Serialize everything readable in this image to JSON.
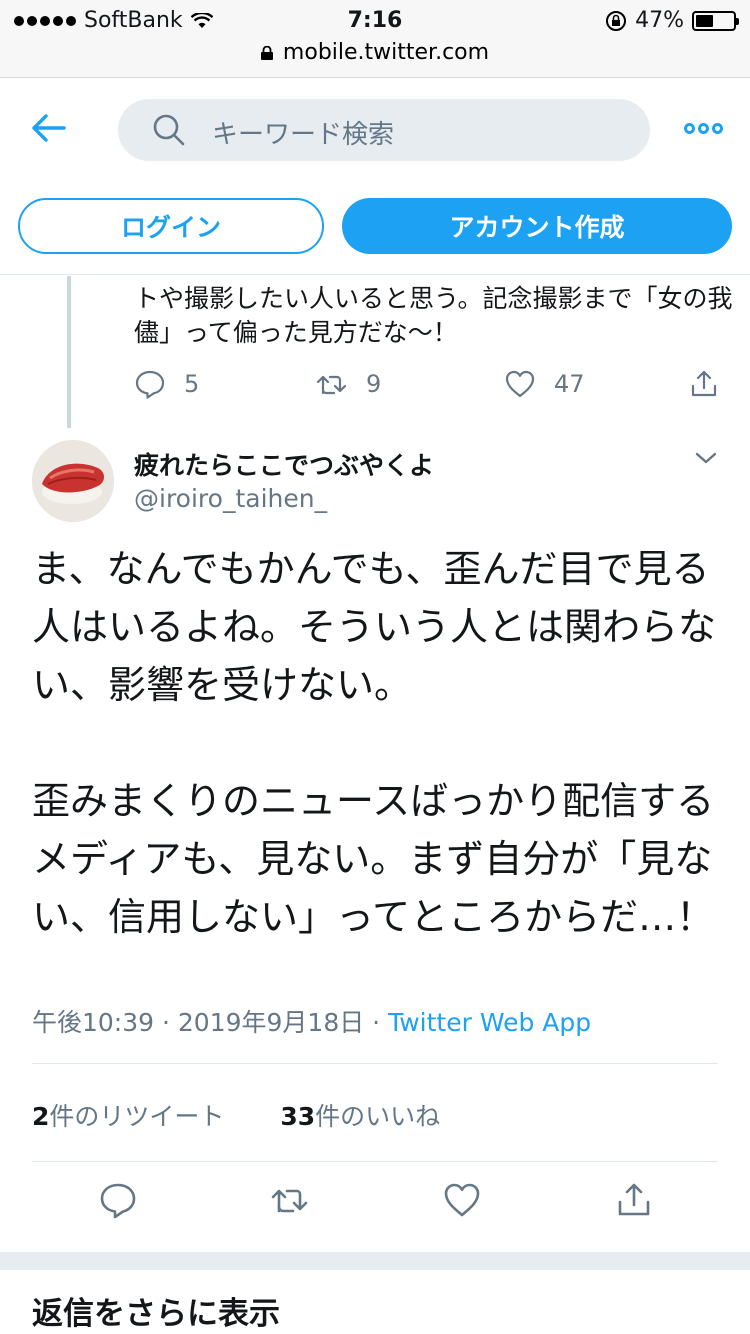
{
  "status": {
    "carrier": "SoftBank",
    "time": "7:16",
    "battery": "47%",
    "battery_level": 0.47
  },
  "browser": {
    "url": "mobile.twitter.com"
  },
  "header": {
    "search_placeholder": "キーワード検索",
    "login_label": "ログイン",
    "signup_label": "アカウント作成",
    "accent": "#1da1f2"
  },
  "prev_tweet": {
    "text": "トや撮影したい人いると思う。記念撮影まで「女の我儘」って偏った見方だな〜！",
    "replies": "5",
    "retweets": "9",
    "likes": "47"
  },
  "tweet": {
    "name": "疲れたらここでつぶやくよ",
    "handle": "@iroiro_taihen_",
    "text": "ま、なんでもかんでも、歪んだ目で見る人はいるよね。そういう人とは関わらない、影響を受けない。\n\n歪みまくりのニュースばっかり配信するメディアも、見ない。まず自分が「見ない、信用しない」ってところからだ…！",
    "time": "午後10:39 · 2019年9月18日 · ",
    "source": "Twitter Web App",
    "retweet_count": "2",
    "retweet_label": "件のリツイート",
    "like_count": "33",
    "like_label": "件のいいね"
  },
  "more_replies_label": "返信をさらに表示"
}
